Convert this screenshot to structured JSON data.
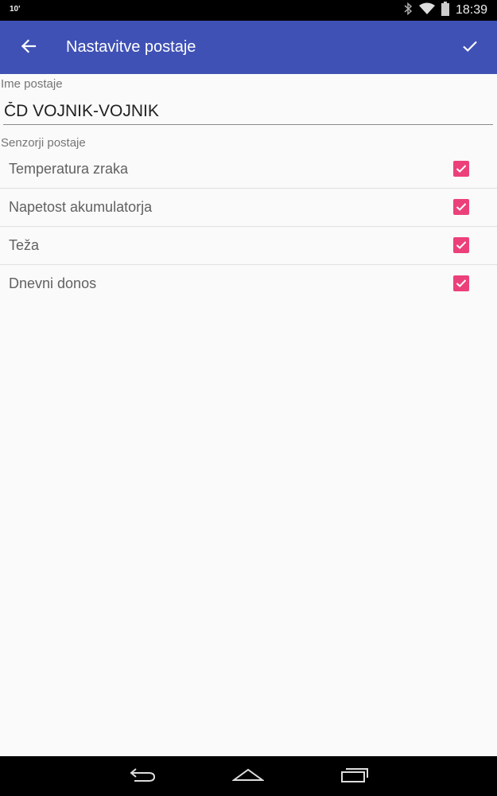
{
  "status_bar": {
    "notification_text": "10'",
    "time": "18:39",
    "icons": [
      "bluetooth-icon",
      "wifi-icon",
      "battery-icon"
    ]
  },
  "app_bar": {
    "title": "Nastavitve postaje",
    "back_icon": "arrow-left-icon",
    "confirm_icon": "check-icon",
    "background_color": "#3f51b5"
  },
  "station": {
    "name_label": "Ime postaje",
    "name_value": "ČD VOJNIK-VOJNIK"
  },
  "sensors": {
    "label": "Senzorji postaje",
    "checkbox_color": "#ec407a",
    "items": [
      {
        "label": "Temperatura zraka",
        "checked": true
      },
      {
        "label": "Napetost akumulatorja",
        "checked": true
      },
      {
        "label": "Teža",
        "checked": true
      },
      {
        "label": "Dnevni donos",
        "checked": true
      }
    ]
  },
  "nav_bar": {
    "icons": [
      "back-nav-icon",
      "home-icon",
      "recents-icon"
    ]
  }
}
